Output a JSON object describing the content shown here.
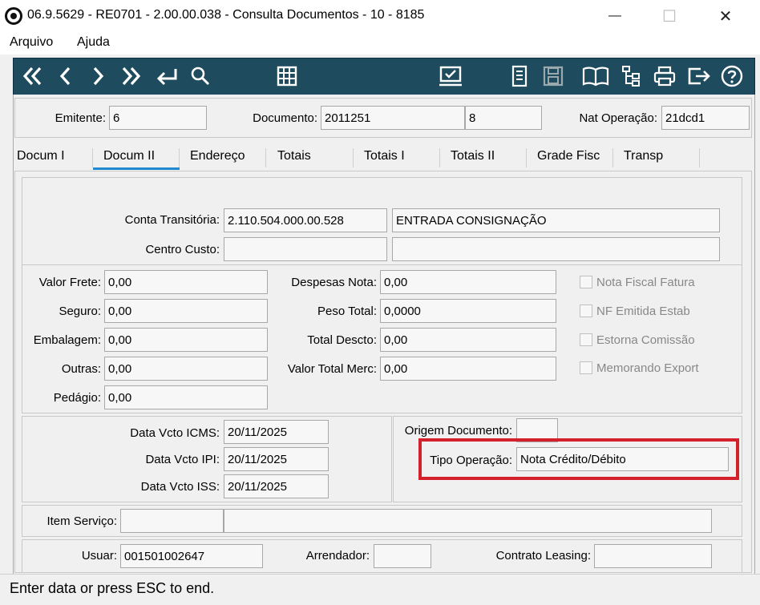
{
  "window": {
    "title": "06.9.5629 - RE0701 - 2.00.00.038 - Consulta Documentos - 10 - 8185",
    "minimize": "—",
    "maximize": "☐",
    "close": "✕"
  },
  "menu": {
    "arquivo": "Arquivo",
    "ajuda": "Ajuda"
  },
  "toolbar": {
    "icons": [
      "first-record-icon",
      "previous-record-icon",
      "next-record-icon",
      "last-record-icon",
      "goto-return-icon",
      "search-icon",
      "grid-icon",
      "checklist-icon",
      "notes-icon",
      "save-icon",
      "book-icon",
      "tree-icon",
      "print-icon",
      "exit-icon",
      "help-icon"
    ]
  },
  "header": {
    "emitente_label": "Emitente:",
    "emitente_value": "6",
    "documento_label": "Documento:",
    "documento_value": "2011251",
    "serie_value": "8",
    "nat_operacao_label": "Nat Operação:",
    "nat_operacao_value": "21dcd1"
  },
  "tabs": [
    "Docum I",
    "Docum II",
    "Endereço",
    "Totais",
    "Totais I",
    "Totais II",
    "Grade Fisc",
    "Transp"
  ],
  "active_tab": "Docum II",
  "conta": {
    "conta_transitoria_label": "Conta Transitória:",
    "conta_transitoria_value": "2.110.504.000.00.528",
    "conta_transitoria_desc": "ENTRADA CONSIGNAÇÃO",
    "centro_custo_label": "Centro Custo:",
    "centro_custo_value": "",
    "centro_custo_desc": ""
  },
  "valores": {
    "valor_frete_label": "Valor Frete:",
    "valor_frete": "0,00",
    "seguro_label": "Seguro:",
    "seguro": "0,00",
    "embalagem_label": "Embalagem:",
    "embalagem": "0,00",
    "outras_label": "Outras:",
    "outras": "0,00",
    "pedagio_label": "Pedágio:",
    "pedagio": "0,00",
    "despesas_nota_label": "Despesas Nota:",
    "despesas_nota": "0,00",
    "peso_total_label": "Peso Total:",
    "peso_total": "0,0000",
    "total_descto_label": "Total Descto:",
    "total_descto": "0,00",
    "valor_total_merc_label": "Valor Total Merc:",
    "valor_total_merc": "0,00"
  },
  "checkboxes": {
    "nota_fiscal_fatura": "Nota Fiscal Fatura",
    "nf_emitida_estab": "NF Emitida Estab",
    "estorna_comissao": "Estorna Comissão",
    "memorando_export": "Memorando Export"
  },
  "datas": {
    "data_vcto_icms_label": "Data Vcto ICMS:",
    "data_vcto_icms": "20/11/2025",
    "data_vcto_ipi_label": "Data Vcto IPI:",
    "data_vcto_ipi": "20/11/2025",
    "data_vcto_iss_label": "Data Vcto ISS:",
    "data_vcto_iss": "20/11/2025"
  },
  "origem": {
    "origem_documento_label": "Origem Documento:",
    "origem_documento": "",
    "tipo_operacao_label": "Tipo Operação:",
    "tipo_operacao": "Nota Crédito/Débito"
  },
  "item_servico": {
    "label": "Item Serviço:",
    "code": "",
    "desc": ""
  },
  "footer_fields": {
    "usuar_label": "Usuar:",
    "usuar": "001501002647",
    "arrendador_label": "Arrendador:",
    "arrendador": "",
    "contrato_leasing_label": "Contrato Leasing:",
    "contrato_leasing": ""
  },
  "status": {
    "text": "Enter data or press ESC to end."
  },
  "colors": {
    "toolbar": "#1e4c5e",
    "tab_active": "#1e88d0",
    "highlight": "#d3202a"
  }
}
